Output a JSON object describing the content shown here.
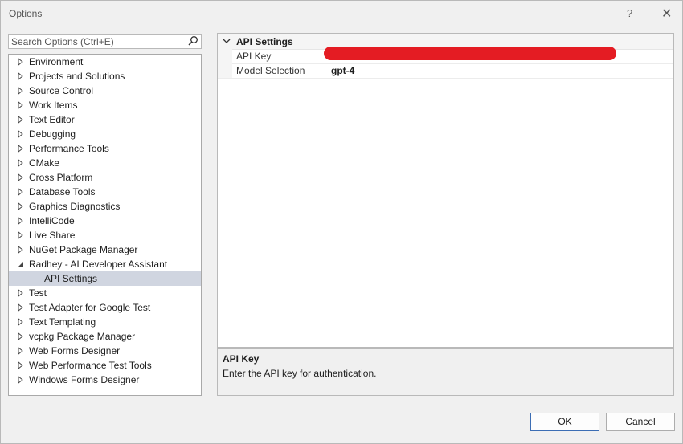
{
  "window": {
    "title": "Options",
    "help_glyph": "?",
    "close_glyph": "✕"
  },
  "search": {
    "placeholder": "Search Options (Ctrl+E)"
  },
  "tree": [
    {
      "label": "Environment"
    },
    {
      "label": "Projects and Solutions"
    },
    {
      "label": "Source Control"
    },
    {
      "label": "Work Items"
    },
    {
      "label": "Text Editor"
    },
    {
      "label": "Debugging"
    },
    {
      "label": "Performance Tools"
    },
    {
      "label": "CMake"
    },
    {
      "label": "Cross Platform"
    },
    {
      "label": "Database Tools"
    },
    {
      "label": "Graphics Diagnostics"
    },
    {
      "label": "IntelliCode"
    },
    {
      "label": "Live Share"
    },
    {
      "label": "NuGet Package Manager"
    },
    {
      "label": "Radhey - AI Developer Assistant"
    },
    {
      "label": "API Settings"
    },
    {
      "label": "Test"
    },
    {
      "label": "Test Adapter for Google Test"
    },
    {
      "label": "Text Templating"
    },
    {
      "label": "vcpkg Package Manager"
    },
    {
      "label": "Web Forms Designer"
    },
    {
      "label": "Web Performance Test Tools"
    },
    {
      "label": "Windows Forms Designer"
    }
  ],
  "properties": {
    "category": "API Settings",
    "rows": [
      {
        "name": "API Key",
        "value": ""
      },
      {
        "name": "Model Selection",
        "value": "gpt-4"
      }
    ]
  },
  "description": {
    "title": "API Key",
    "text": "Enter the API key for authentication."
  },
  "buttons": {
    "ok": "OK",
    "cancel": "Cancel"
  }
}
